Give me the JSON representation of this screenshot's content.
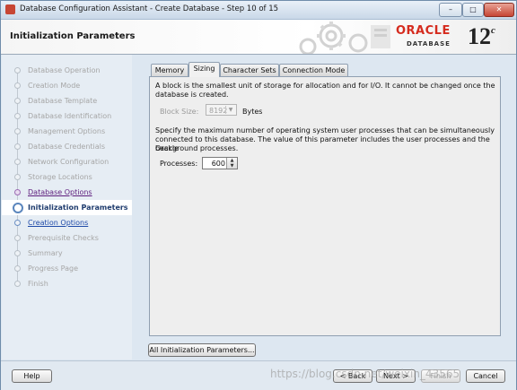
{
  "window": {
    "title": "Database Configuration Assistant - Create Database - Step 10 of 15",
    "controls": {
      "minimize": "–",
      "maximize": "□",
      "close": "✕"
    }
  },
  "banner": {
    "heading": "Initialization Parameters",
    "logo_brand": "ORACLE",
    "logo_product": "DATABASE",
    "logo_version": "12",
    "logo_version_suffix": "c"
  },
  "steps": [
    {
      "label": "Database Operation",
      "state": "disabled"
    },
    {
      "label": "Creation Mode",
      "state": "disabled"
    },
    {
      "label": "Database Template",
      "state": "disabled"
    },
    {
      "label": "Database Identification",
      "state": "disabled"
    },
    {
      "label": "Management Options",
      "state": "disabled"
    },
    {
      "label": "Database Credentials",
      "state": "disabled"
    },
    {
      "label": "Network Configuration",
      "state": "disabled"
    },
    {
      "label": "Storage Locations",
      "state": "disabled"
    },
    {
      "label": "Database Options",
      "state": "visited"
    },
    {
      "label": "Initialization Parameters",
      "state": "current"
    },
    {
      "label": "Creation Options",
      "state": "link"
    },
    {
      "label": "Prerequisite Checks",
      "state": "disabled"
    },
    {
      "label": "Summary",
      "state": "disabled"
    },
    {
      "label": "Progress Page",
      "state": "disabled"
    },
    {
      "label": "Finish",
      "state": "disabled"
    }
  ],
  "tabs": [
    {
      "label": "Memory",
      "active": false
    },
    {
      "label": "Sizing",
      "active": true
    },
    {
      "label": "Character Sets",
      "active": false
    },
    {
      "label": "Connection Mode",
      "active": false
    }
  ],
  "sizing": {
    "block_text_1": "A block is the smallest unit of storage for allocation and for I/O. It cannot be changed once the",
    "block_text_2": "database is created.",
    "block_size_label": "Block Size:",
    "block_size_value": "8192",
    "block_size_unit": "Bytes",
    "processes_text_1": "Specify the maximum number of operating system user processes that can be simultaneously",
    "processes_text_2": "connected to this database. The value of this parameter includes the user processes and the Oracle",
    "processes_text_3": "background processes.",
    "processes_label": "Processes:",
    "processes_value": "600"
  },
  "buttons": {
    "all_params": "All Initialization Parameters...",
    "help": "Help",
    "back": "< Back",
    "next": "Next >",
    "finish": "Finish",
    "cancel": "Cancel"
  },
  "watermark": "https://blog.csdn.net/weixin_43565"
}
